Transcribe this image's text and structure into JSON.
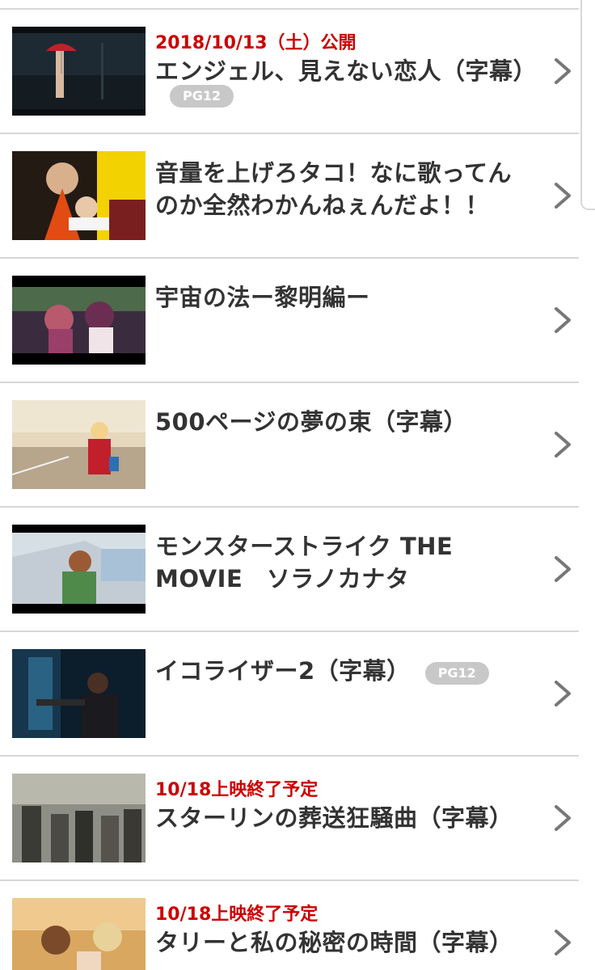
{
  "movies": [
    {
      "note": "2018/10/13（土）公開",
      "title": "エンジェル、見えない恋人（字幕）",
      "rating": "PG12"
    },
    {
      "note": "",
      "title": "音量を上げろタコ！なに歌ってんのか全然わかんねぇんだよ！！",
      "rating": ""
    },
    {
      "note": "",
      "title": "宇宙の法ー黎明編ー",
      "rating": ""
    },
    {
      "note": "",
      "title": "500ページの夢の束（字幕）",
      "rating": ""
    },
    {
      "note": "",
      "title": "モンスターストライク THE MOVIE　ソラノカナタ",
      "rating": ""
    },
    {
      "note": "",
      "title": "イコライザー2（字幕）",
      "rating": "PG12"
    },
    {
      "note": "10/18上映終了予定",
      "title": "スターリンの葬送狂騒曲（字幕）",
      "rating": ""
    },
    {
      "note": "10/18上映終了予定",
      "title": "タリーと私の秘密の時間（字幕）",
      "rating": ""
    }
  ],
  "colors": {
    "note_red": "#cc0000",
    "title_text": "#333333",
    "badge_bg": "#c8c8c8",
    "divider": "#d7d7d7",
    "chevron": "#777777"
  },
  "icons": {
    "row_arrow": "chevron-right-icon"
  }
}
